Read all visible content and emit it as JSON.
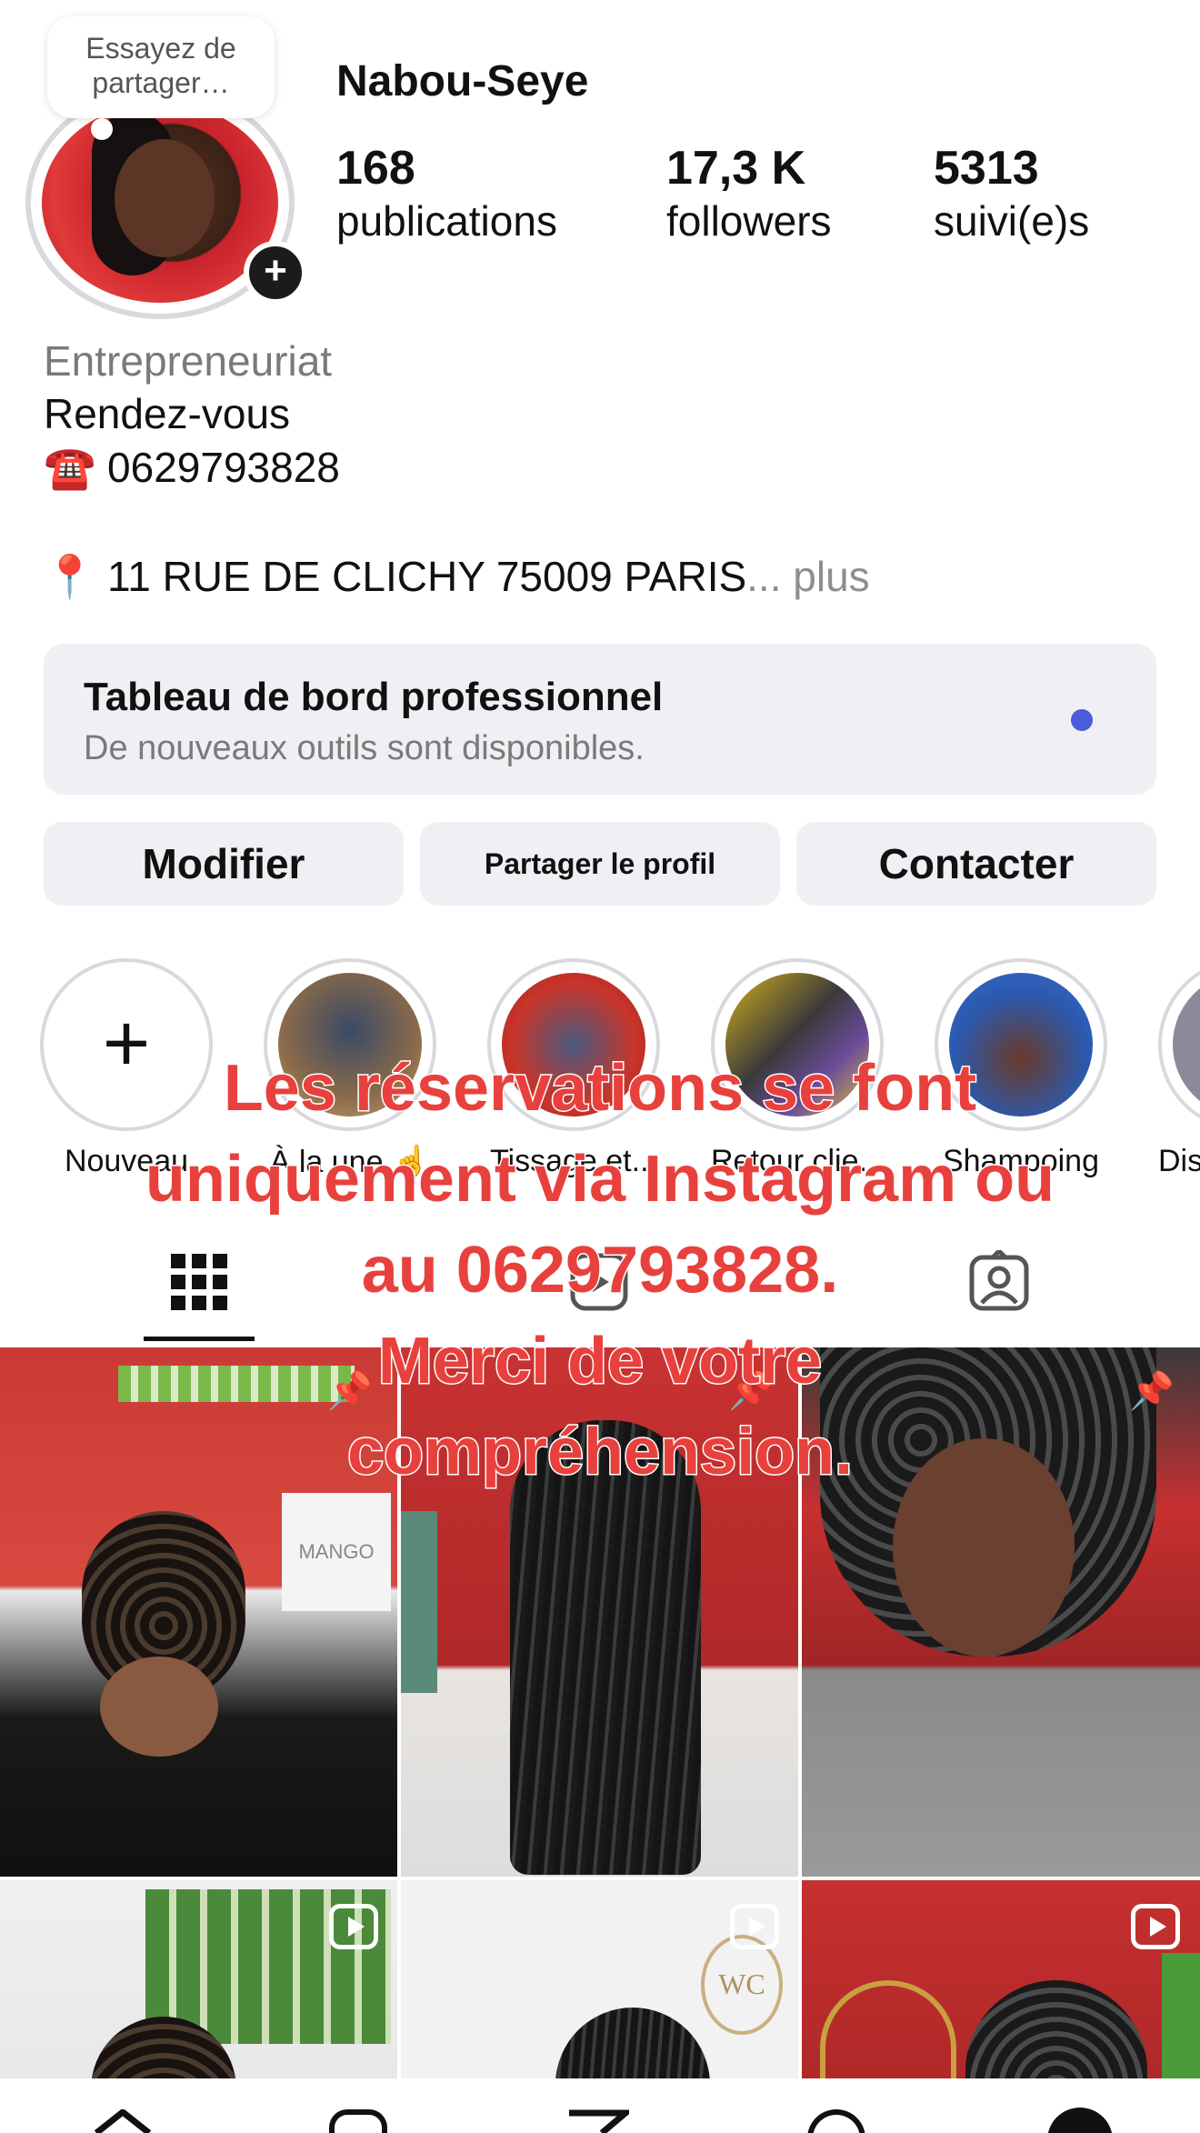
{
  "profile": {
    "username": "Nabou-Seye",
    "note": "Essayez de partager…",
    "stats": [
      {
        "value": "168",
        "label": "publications"
      },
      {
        "value": "17,3 K",
        "label": "followers"
      },
      {
        "value": "5313",
        "label": "suivi(e)s"
      }
    ],
    "category": "Entrepreneuriat",
    "bio_line1": "Rendez-vous",
    "bio_phone": "☎️ 0629793828",
    "bio_address": "📍 11 RUE DE CLICHY 75009 PARIS",
    "bio_more": "... plus"
  },
  "dashboard": {
    "title": "Tableau de bord professionnel",
    "subtitle": "De nouveaux outils sont disponibles."
  },
  "buttons": {
    "edit": "Modifier",
    "share": "Partager le profil",
    "contact": "Contacter"
  },
  "highlights": [
    {
      "label": "Nouveau"
    },
    {
      "label": "À la une ☝️"
    },
    {
      "label": "Tissage et..."
    },
    {
      "label": "Retour clie..."
    },
    {
      "label": "Shampoing"
    },
    {
      "label": "Disp..."
    }
  ],
  "overlay": {
    "line1": "Les réservations se font",
    "line2": "uniquement via Instagram ou",
    "line3": "au 0629793828.",
    "line4": "Merci de votre",
    "line5": "compréhension."
  },
  "posts": {
    "shelf_text": "MANGO",
    "logo_text": "WC"
  },
  "colors": {
    "overlay_text": "#e8413d",
    "dashboard_dot": "#4a5bdc",
    "button_bg": "#eef0f3"
  },
  "icons": [
    "plus-icon",
    "grid-icon",
    "reels-icon",
    "tagged-icon",
    "pin-icon",
    "reel-icon",
    "home-icon",
    "search-icon",
    "send-icon",
    "profile-icon"
  ]
}
